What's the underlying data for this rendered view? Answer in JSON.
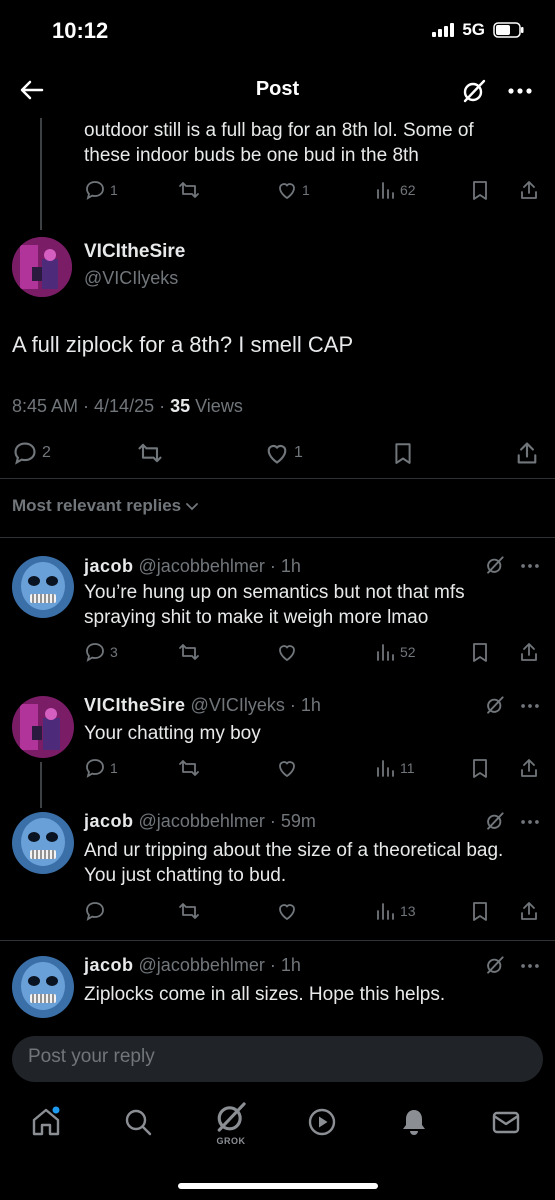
{
  "status_bar": {
    "time": "10:12",
    "network": "5G"
  },
  "header": {
    "title": "Post"
  },
  "parent_post": {
    "text": "outdoor still is a full bag for an 8th lol. Some of these indoor buds be one bud in the 8th",
    "replies": "1",
    "likes": "1",
    "views": "62"
  },
  "main_post": {
    "name": "VICItheSire",
    "handle": "@VICIlyeks",
    "text": "A full ziplock for a 8th? I smell CAP",
    "time": "8:45 AM · 4/14/25 · ",
    "views_count": "35",
    "views_label": " Views",
    "replies": "2",
    "likes": "1"
  },
  "sort": {
    "label": "Most relevant replies"
  },
  "replies": [
    {
      "name": "jacob",
      "handle": "@jacobbehlmer · 1h",
      "text": "You’re hung up on semantics but not that mfs spraying shit to make it weigh more lmao",
      "reply_count": "3",
      "views": "52"
    },
    {
      "name": "VICItheSire",
      "handle": "@VICIlyeks · 1h",
      "text": "Your chatting my boy",
      "reply_count": "1",
      "views": "11"
    },
    {
      "name": "jacob",
      "handle": "@jacobbehlmer · 59m",
      "text": "And ur tripping about the size of a theoretical bag. You just chatting to bud.",
      "reply_count": "",
      "views": "13"
    },
    {
      "name": "jacob",
      "handle": "@jacobbehlmer · 1h",
      "text": "Ziplocks come in all sizes. Hope this helps."
    }
  ],
  "compose": {
    "placeholder": "Post your reply"
  },
  "tabbar": {
    "grok_label": "GROK"
  },
  "colors": {
    "background": "#000000",
    "muted": "#71767b",
    "text": "#e7e9ea",
    "notification_dot": "#1d9bf0"
  }
}
